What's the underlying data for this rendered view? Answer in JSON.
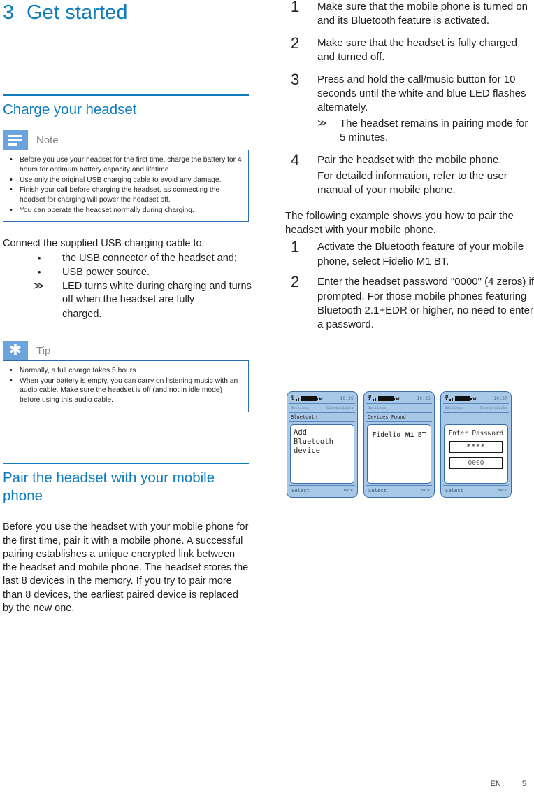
{
  "chapter": {
    "number": "3",
    "title": "Get started"
  },
  "left": {
    "section_charge": {
      "heading": "Charge your headset"
    },
    "note": {
      "label": "Note",
      "icon": "note-lines-icon",
      "items": [
        "Before you use your headset for the first time, charge the battery for 4 hours for optimum battery capacity and lifetime.",
        "Use  only the original USB charging cable  to avoid any damage.",
        "Finish your call before charging  the headset, as connecting  the headset for charging  will power the headset off.",
        "You can operate the headset normally  during charging."
      ]
    },
    "connect": {
      "intro": "Connect the supplied USB charging cable to:",
      "bullets": [
        {
          "marker": "•",
          "text": "the USB connector of the headset and;"
        },
        {
          "marker": "•",
          "text": "USB power source."
        },
        {
          "marker": "≫",
          "text": "LED turns white during charging and turns off when the headset are fully"
        },
        {
          "marker": "",
          "text": "charged."
        }
      ]
    },
    "tip": {
      "label": "Tip",
      "icon": "asterisk-star-icon",
      "items": [
        "Normally, a full charge takes 5 hours.",
        "When  your battery is empty, you can carry on listening music with an audio cable. Make sure  the headset is off (and  not in idle mode) before using this  audio cable."
      ]
    },
    "section_pair": {
      "heading": "Pair the headset with your mobile phone"
    },
    "pair_paragraph": "Before you use the headset with your mobile phone for the first time, pair it with a mobile phone. A successful pairing establishes a unique encrypted link between the headset and mobile phone.  The headset stores the last 8 devices in the memory. If you try to pair more than 8 devices, the earliest paired device is replaced by the new one."
  },
  "right": {
    "steps_main": [
      {
        "num": "1",
        "text": "Make sure that the mobile phone is turned on and its Bluetooth feature is activated."
      },
      {
        "num": "2",
        "text": "Make sure that the headset is fully charged and turned off."
      },
      {
        "num": "3",
        "text": "Press and hold the call/music button for 10 seconds until the white and blue LED flashes alternately.",
        "sub": {
          "marker": "≫",
          "text": "The headset remains in pairing mode for 5 minutes."
        }
      },
      {
        "num": "4",
        "text": "Pair the headset with the mobile phone.",
        "extra": "For detailed information, refer to the user manual of your mobile phone."
      }
    ],
    "example_intro": "The following example shows you how to pair the headset with your mobile phone.",
    "steps_example": [
      {
        "num": "1",
        "text": "Activate the Bluetooth feature of your mobile phone, select Fidelio M1 BT."
      },
      {
        "num": "2",
        "text": "Enter the headset password \"0000\" (4 zeros) if prompted.  For those mobile phones featuring Bluetooth 2.1+EDR or higher, no need to enter a password."
      }
    ],
    "phones": [
      {
        "time": "10:35",
        "menu_left": "Settings",
        "menu_right": "Connectivity",
        "title": "Bluetooth",
        "screen_lines": [
          "Add",
          "Bluetooth",
          "device"
        ],
        "soft_left": "Select",
        "soft_right": "Back"
      },
      {
        "time": "10:36",
        "menu_left": "Settings",
        "menu_right": "",
        "title": "Devices Found",
        "device_prefix": "Fidelio ",
        "device_bold": "M1",
        "device_suffix": " BT",
        "soft_left": "Select",
        "soft_right": "Back"
      },
      {
        "time": "10:37",
        "menu_left": "Settings",
        "menu_right": "Connectivity",
        "title": "",
        "password_title": "Enter Password",
        "password_masked": "****",
        "password_value": "0000",
        "soft_left": "Select",
        "soft_right": "Back"
      }
    ]
  },
  "footer": {
    "language": "EN",
    "page": "5"
  },
  "colors": {
    "brand_blue": "#0f7cc0",
    "callout_icon_blue": "#6ba4dd",
    "callout_border": "#2b6db3",
    "phone_body": "#a8c8e8"
  }
}
